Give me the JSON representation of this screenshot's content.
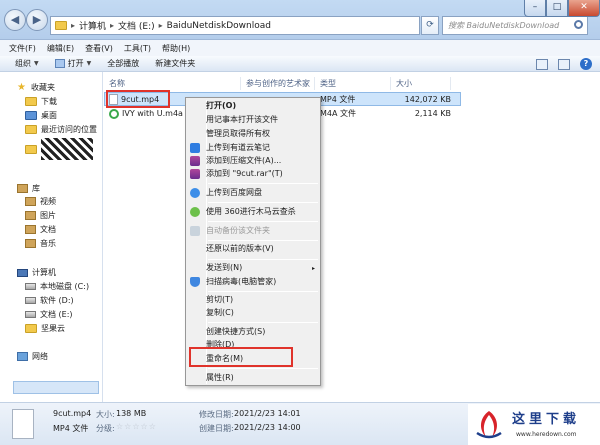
{
  "address": {
    "crumbs": [
      "计算机",
      "文档 (E:)",
      "BaiduNetdiskDownload"
    ],
    "separator": "▸"
  },
  "search": {
    "placeholder": "搜索 BaiduNetdiskDownload"
  },
  "window_controls": {
    "minimize": "–",
    "maximize": "□",
    "close": "✕"
  },
  "menu": [
    "文件(F)",
    "编辑(E)",
    "查看(V)",
    "工具(T)",
    "帮助(H)"
  ],
  "toolbar": {
    "organize": "组织",
    "open": "打开",
    "play_all": "全部播放",
    "new_folder": "新建文件夹",
    "help": "?"
  },
  "nav": {
    "favorites": "收藏夹",
    "downloads": "下载",
    "desktop": "桌面",
    "recent": "最近访问的位置",
    "libraries": "库",
    "videos": "视频",
    "pictures": "图片",
    "documents": "文档",
    "music": "音乐",
    "computer": "计算机",
    "drive_c": "本地磁盘 (C:)",
    "drive_d": "软件 (D:)",
    "drive_e": "文档 (E:)",
    "drive_f": "坚果云",
    "network": "网络"
  },
  "columns": {
    "name": "名称",
    "artist": "参与创作的艺术家",
    "type": "类型",
    "size": "大小"
  },
  "files": [
    {
      "name": "9cut.mp4",
      "type": "MP4 文件",
      "size": "142,072 KB"
    },
    {
      "name": "IVY with U.m4a",
      "type": "M4A 文件",
      "size": "2,114 KB"
    }
  ],
  "context_menu": {
    "open": "打开(O)",
    "notepad": "用记事本打开该文件",
    "admin": "管理员取得所有权",
    "youdao": "上传到有道云笔记",
    "add_archive": "添加到压缩文件(A)...",
    "add_rar": "添加到 \"9cut.rar\"(T)",
    "baidu": "上传到百度网盘",
    "scan360": "使用 360进行木马云查杀",
    "auto_backup": "自动备份该文件夹",
    "restore": "还原以前的版本(V)",
    "send_to": "发送到(N)",
    "virus_scan": "扫描病毒(电脑管家)",
    "cut": "剪切(T)",
    "copy": "复制(C)",
    "shortcut": "创建快捷方式(S)",
    "delete": "删除(D)",
    "rename": "重命名(M)",
    "properties": "属性(R)",
    "arrow": "▸"
  },
  "details": {
    "filename": "9cut.mp4",
    "size_label": "大小:",
    "size": "138 MB",
    "filetype": "MP4 文件",
    "rating_label": "分级:",
    "stars": "☆☆☆☆☆",
    "modified_label": "修改日期:",
    "modified": "2021/2/23 14:01",
    "created_label": "创建日期:",
    "created": "2021/2/23 14:00"
  },
  "watermark": {
    "title": "这里下载",
    "url": "www.heredown.com"
  },
  "colors": {
    "highlight_box": "#e0332b",
    "selection": "#cde4fb",
    "title_bar": "#c3daf3"
  }
}
